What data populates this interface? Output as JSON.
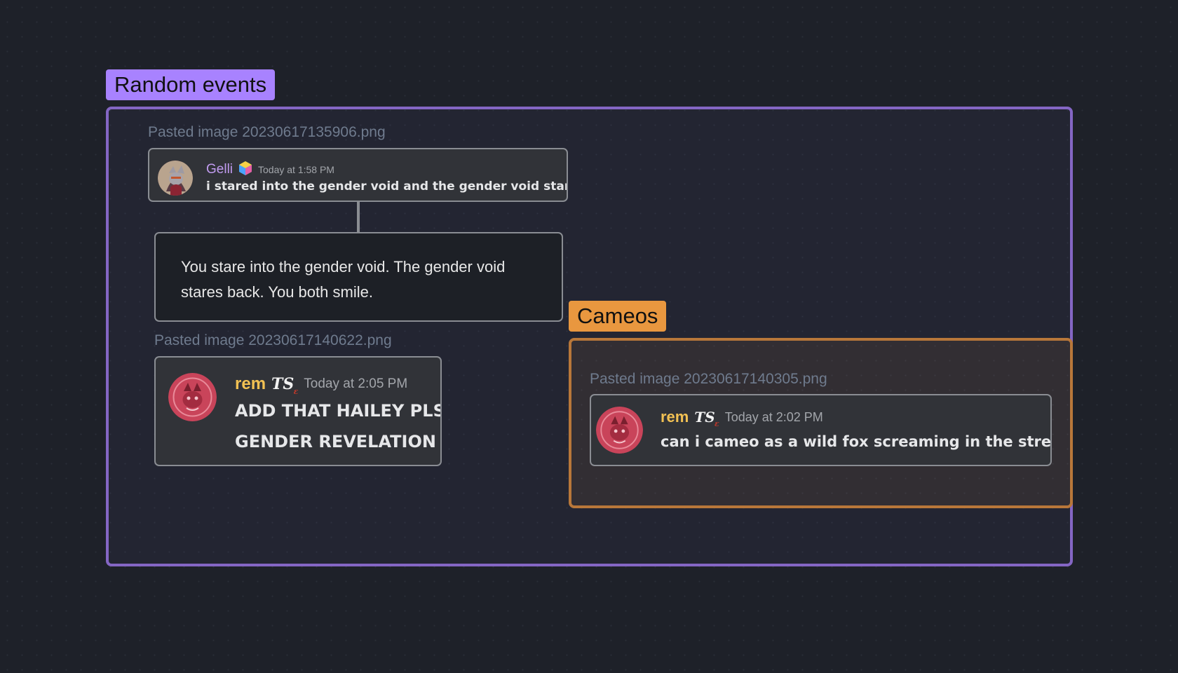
{
  "canvas": {
    "groups": [
      {
        "label": "Random events",
        "color": "#a882ff"
      },
      {
        "label": "Cameos",
        "color": "#e9973f"
      }
    ],
    "nodes": {
      "gelli_image": {
        "filename": "Pasted image 20230617135906.png",
        "username": "Gelli",
        "timestamp": "Today at 1:58 PM",
        "message": "i stared into the gender void and the gender void stared back"
      },
      "text_card": {
        "text": "You stare into the gender void. The gender void stares back. You both smile."
      },
      "rem_image_1": {
        "filename": "Pasted image 20230617140622.png",
        "username": "rem",
        "badge": "TS",
        "timestamp": "Today at 2:05 PM",
        "message_line1": "ADD THAT HAILEY PLS",
        "message_line2": "GENDER REVELATION"
      },
      "rem_image_2": {
        "filename": "Pasted image 20230617140305.png",
        "username": "rem",
        "badge": "TS",
        "timestamp": "Today at 2:02 PM",
        "message": "can i cameo as a wild fox screaming in the street"
      }
    }
  }
}
